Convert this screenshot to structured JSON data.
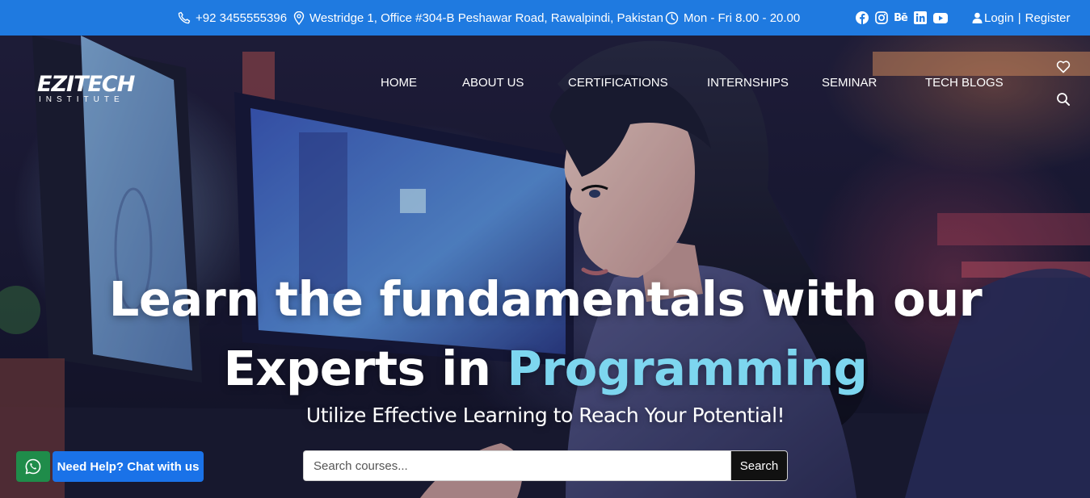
{
  "topbar": {
    "phone": "+92 3455555396",
    "address": "Westridge 1, Office #304-B Peshawar Road, Rawalpindi, Pakistan",
    "hours": "Mon - Fri 8.00 - 20.00",
    "social_icons": [
      "facebook-icon",
      "instagram-icon",
      "behance-icon",
      "linkedin-icon",
      "youtube-icon"
    ],
    "login": "Login",
    "separator": "|",
    "register": "Register",
    "bg_color": "#1f7ae0"
  },
  "logo": {
    "main": "EZITECH",
    "sub": "INSTITUTE"
  },
  "nav": {
    "items": [
      "HOME",
      "ABOUT US",
      "CERTIFICATIONS",
      "INTERNSHIPS",
      "SEMINAR",
      "TECH BLOGS"
    ],
    "icons": [
      "heart-icon",
      "search-icon"
    ]
  },
  "hero": {
    "headline_line1": "Learn the fundamentals with our",
    "headline_line2_prefix": "Experts in ",
    "headline_accent": "Programming",
    "subline": "Utilize Effective Learning to Reach Your Potential!",
    "accent_color": "#7dd6ef"
  },
  "search": {
    "placeholder": "Search courses...",
    "value": "",
    "button": "Search"
  },
  "chat": {
    "icon": "whatsapp-icon",
    "label": "Need Help? Chat with us",
    "whatsapp_color": "#1f8c4a",
    "button_color": "#1a72e8"
  }
}
